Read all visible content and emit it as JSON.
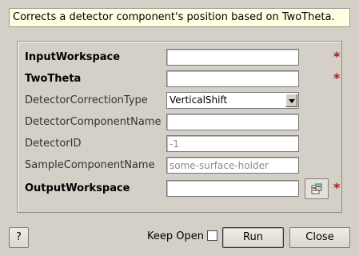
{
  "description": "Corrects a detector component's position based on TwoTheta.",
  "fields": [
    {
      "label": "InputWorkspace",
      "value": "",
      "placeholder": ""
    },
    {
      "label": "TwoTheta",
      "value": "",
      "placeholder": ""
    },
    {
      "label": "DetectorCorrectionType",
      "value": "VerticalShift"
    },
    {
      "label": "DetectorComponentName",
      "value": "",
      "placeholder": ""
    },
    {
      "label": "DetectorID",
      "value": "",
      "placeholder": "-1"
    },
    {
      "label": "SampleComponentName",
      "value": "",
      "placeholder": "some-surface-holder"
    },
    {
      "label": "OutputWorkspace",
      "value": "",
      "placeholder": ""
    }
  ],
  "required_marker": "*",
  "footer": {
    "help_label": "?",
    "keep_open_label": "Keep Open",
    "keep_open_checked": false,
    "run_label": "Run",
    "close_label": "Close"
  },
  "icons": {
    "browse": "workspace-browse-icon",
    "required": "required-asterisk-icon",
    "dropdown": "chevron-down-icon"
  },
  "colors": {
    "background": "#d4d0c8",
    "description_bg": "#ffffe1",
    "required_marker": "#b01818"
  }
}
